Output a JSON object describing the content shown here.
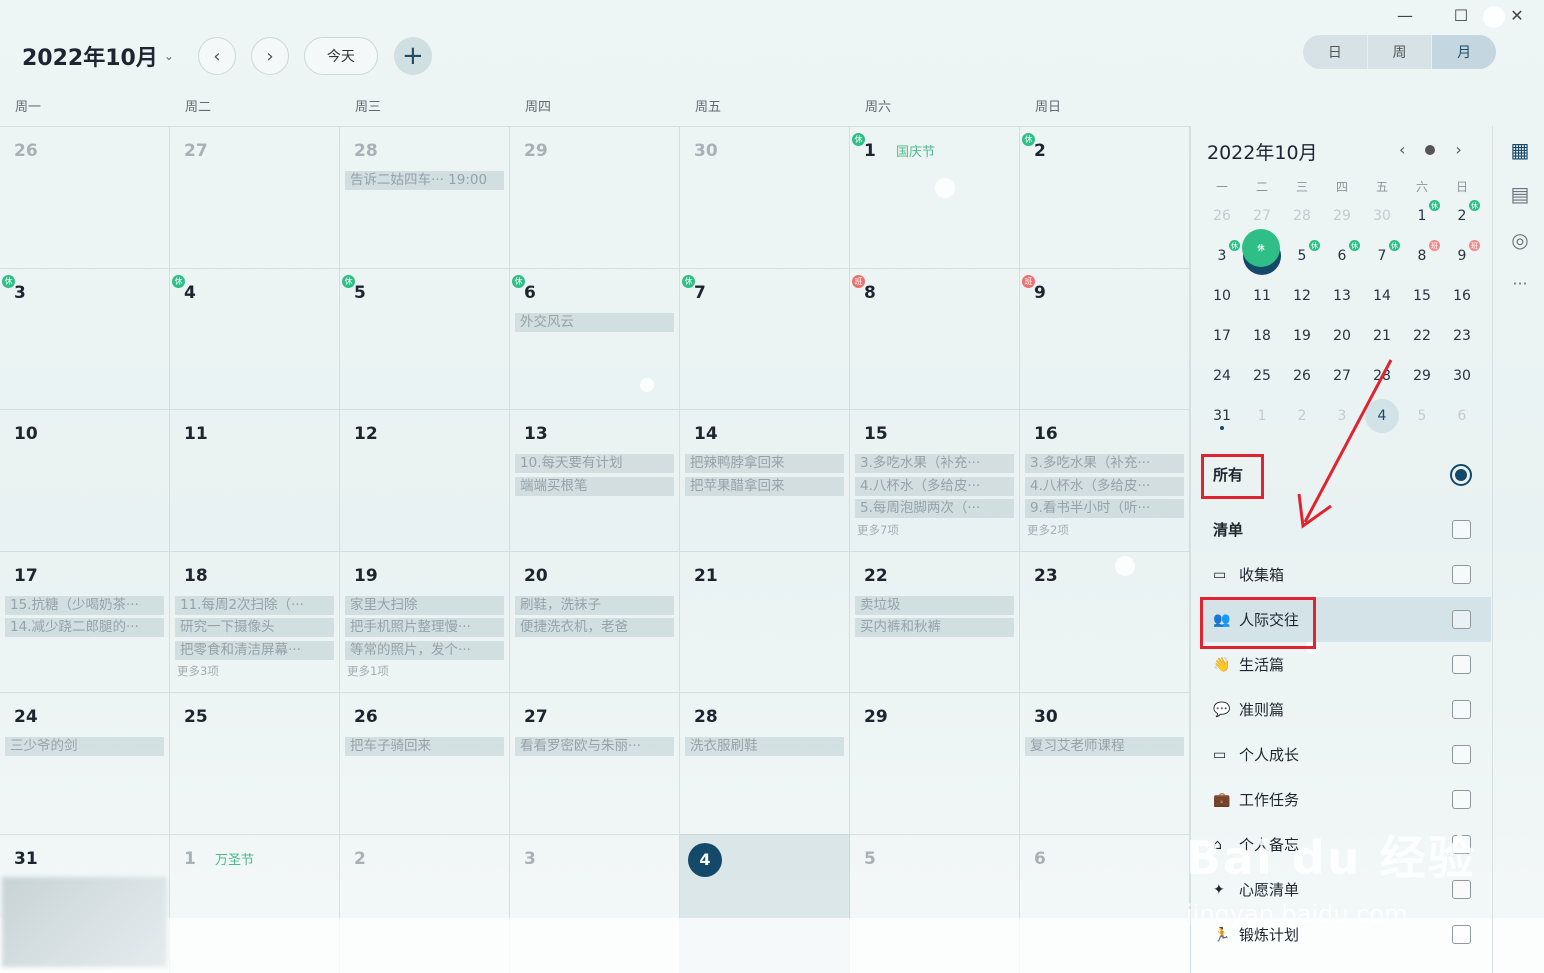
{
  "window": {
    "minimize": "—",
    "maximize": "☐",
    "close": "✕"
  },
  "header": {
    "title": "2022年10月",
    "today_label": "今天",
    "add_label": "+",
    "prev_label": "‹",
    "next_label": "›"
  },
  "view_switch": {
    "day": "日",
    "week": "周",
    "month": "月",
    "active": "month"
  },
  "weekdays": [
    "周一",
    "周二",
    "周三",
    "周四",
    "周五",
    "周六",
    "周日"
  ],
  "weeks": [
    [
      {
        "day": "26",
        "dim": true,
        "tasks": []
      },
      {
        "day": "27",
        "dim": true,
        "tasks": []
      },
      {
        "day": "28",
        "dim": true,
        "tasks": [
          "告诉二姑四车··· 19:00"
        ]
      },
      {
        "day": "29",
        "dim": true,
        "tasks": []
      },
      {
        "day": "30",
        "dim": true,
        "tasks": []
      },
      {
        "day": "1",
        "badge": "rest",
        "badge_text": "休",
        "holiday": "国庆节",
        "tasks": []
      },
      {
        "day": "2",
        "badge": "rest",
        "badge_text": "休",
        "tasks": []
      }
    ],
    [
      {
        "day": "3",
        "badge": "rest",
        "badge_text": "休",
        "tasks": []
      },
      {
        "day": "4",
        "badge": "rest",
        "badge_text": "休",
        "tasks": []
      },
      {
        "day": "5",
        "badge": "rest",
        "badge_text": "休",
        "tasks": []
      },
      {
        "day": "6",
        "badge": "rest",
        "badge_text": "休",
        "tasks": [
          "外交风云"
        ]
      },
      {
        "day": "7",
        "badge": "rest",
        "badge_text": "休",
        "tasks": []
      },
      {
        "day": "8",
        "badge": "work",
        "badge_text": "班",
        "tasks": []
      },
      {
        "day": "9",
        "badge": "work",
        "badge_text": "班",
        "tasks": []
      }
    ],
    [
      {
        "day": "10",
        "tasks": []
      },
      {
        "day": "11",
        "tasks": []
      },
      {
        "day": "12",
        "tasks": []
      },
      {
        "day": "13",
        "tasks": [
          "10.每天要有计划",
          "端端买根笔"
        ]
      },
      {
        "day": "14",
        "tasks": [
          "把辣鸭脖拿回来",
          "把苹果醋拿回来"
        ]
      },
      {
        "day": "15",
        "tasks": [
          "3.多吃水果（补充···",
          "4.八杯水（多给皮···",
          "5.每周泡脚两次（···"
        ],
        "more": "更多7项"
      },
      {
        "day": "16",
        "tasks": [
          "3.多吃水果（补充···",
          "4.八杯水（多给皮···",
          "9.看书半小时（听···"
        ],
        "more": "更多2项"
      }
    ],
    [
      {
        "day": "17",
        "tasks": [
          "15.抗糖（少喝奶茶···",
          "14.减少跷二郎腿的···"
        ]
      },
      {
        "day": "18",
        "tasks": [
          "11.每周2次扫除（···",
          "研究一下摄像头",
          "把零食和清洁屏幕···"
        ],
        "more": "更多3项"
      },
      {
        "day": "19",
        "tasks": [
          "家里大扫除",
          "把手机照片整理慢···",
          "等常的照片，发个···"
        ],
        "more": "更多1项"
      },
      {
        "day": "20",
        "tasks": [
          "刷鞋，洗袜子",
          "便捷洗衣机，老爸"
        ]
      },
      {
        "day": "21",
        "tasks": []
      },
      {
        "day": "22",
        "tasks": [
          "卖垃圾",
          "买内裤和秋裤"
        ]
      },
      {
        "day": "23",
        "tasks": []
      }
    ],
    [
      {
        "day": "24",
        "tasks": [
          "三少爷的剑"
        ]
      },
      {
        "day": "25",
        "tasks": []
      },
      {
        "day": "26",
        "tasks": [
          "把车子骑回来"
        ]
      },
      {
        "day": "27",
        "tasks": [
          "看看罗密欧与朱丽···"
        ]
      },
      {
        "day": "28",
        "tasks": [
          "洗衣服刷鞋"
        ]
      },
      {
        "day": "29",
        "tasks": []
      },
      {
        "day": "30",
        "tasks": [
          "复习艾老师课程"
        ]
      }
    ],
    [
      {
        "day": "31",
        "tasks": []
      },
      {
        "day": "1",
        "dim": true,
        "holiday": "万圣节",
        "tasks": []
      },
      {
        "day": "2",
        "dim": true,
        "tasks": []
      },
      {
        "day": "3",
        "dim": true,
        "tasks": []
      },
      {
        "day": "4",
        "today": true,
        "tasks": []
      },
      {
        "day": "5",
        "dim": true,
        "tasks": []
      },
      {
        "day": "6",
        "dim": true,
        "tasks": []
      }
    ]
  ],
  "mini_calendar": {
    "title": "2022年10月",
    "headers": [
      "一",
      "二",
      "三",
      "四",
      "五",
      "六",
      "日"
    ],
    "rows": [
      [
        {
          "d": "26",
          "dim": true
        },
        {
          "d": "27",
          "dim": true
        },
        {
          "d": "28",
          "dim": true
        },
        {
          "d": "29",
          "dim": true
        },
        {
          "d": "30",
          "dim": true
        },
        {
          "d": "1",
          "b": "rest"
        },
        {
          "d": "2",
          "b": "rest"
        }
      ],
      [
        {
          "d": "3",
          "b": "rest"
        },
        {
          "d": "4",
          "b": "rest",
          "sel": true
        },
        {
          "d": "5",
          "b": "rest"
        },
        {
          "d": "6",
          "b": "rest"
        },
        {
          "d": "7",
          "b": "rest"
        },
        {
          "d": "8",
          "b": "work"
        },
        {
          "d": "9",
          "b": "work"
        }
      ],
      [
        {
          "d": "10"
        },
        {
          "d": "11"
        },
        {
          "d": "12"
        },
        {
          "d": "13"
        },
        {
          "d": "14"
        },
        {
          "d": "15"
        },
        {
          "d": "16"
        }
      ],
      [
        {
          "d": "17"
        },
        {
          "d": "18"
        },
        {
          "d": "19"
        },
        {
          "d": "20"
        },
        {
          "d": "21"
        },
        {
          "d": "22"
        },
        {
          "d": "23"
        }
      ],
      [
        {
          "d": "24"
        },
        {
          "d": "25"
        },
        {
          "d": "26"
        },
        {
          "d": "27"
        },
        {
          "d": "28"
        },
        {
          "d": "29"
        },
        {
          "d": "30"
        }
      ],
      [
        {
          "d": "31",
          "dot": true
        },
        {
          "d": "1",
          "dim": true
        },
        {
          "d": "2",
          "dim": true
        },
        {
          "d": "3",
          "dim": true
        },
        {
          "d": "4",
          "sel2": true
        },
        {
          "d": "5",
          "dim": true
        },
        {
          "d": "6",
          "dim": true
        }
      ]
    ],
    "rest_text": "休",
    "work_text": "班"
  },
  "lists": {
    "all_label": "所有",
    "section_label": "清单",
    "items": [
      {
        "label": "收集箱",
        "icon": "inbox-icon",
        "glyph": "▭"
      },
      {
        "label": "人际交往",
        "icon": "people-icon",
        "glyph": "👥"
      },
      {
        "label": "生活篇",
        "icon": "hand-icon",
        "glyph": "👋"
      },
      {
        "label": "准则篇",
        "icon": "message-icon",
        "glyph": "💬"
      },
      {
        "label": "个人成长",
        "icon": "book-icon",
        "glyph": "▭"
      },
      {
        "label": "工作任务",
        "icon": "briefcase-icon",
        "glyph": "💼"
      },
      {
        "label": "个人备忘",
        "icon": "house-icon",
        "glyph": "⌂"
      },
      {
        "label": "心愿清单",
        "icon": "wish-icon",
        "glyph": "✦"
      },
      {
        "label": "锻炼计划",
        "icon": "run-icon",
        "glyph": "🏃"
      }
    ]
  },
  "watermark": {
    "main": "Bai du 经验",
    "sub": "jingyan.baidu.com"
  },
  "colors": {
    "accent": "#15496a",
    "rest": "#2fbf86",
    "work": "#ee6f6f",
    "highlight_box": "#e0242f"
  }
}
